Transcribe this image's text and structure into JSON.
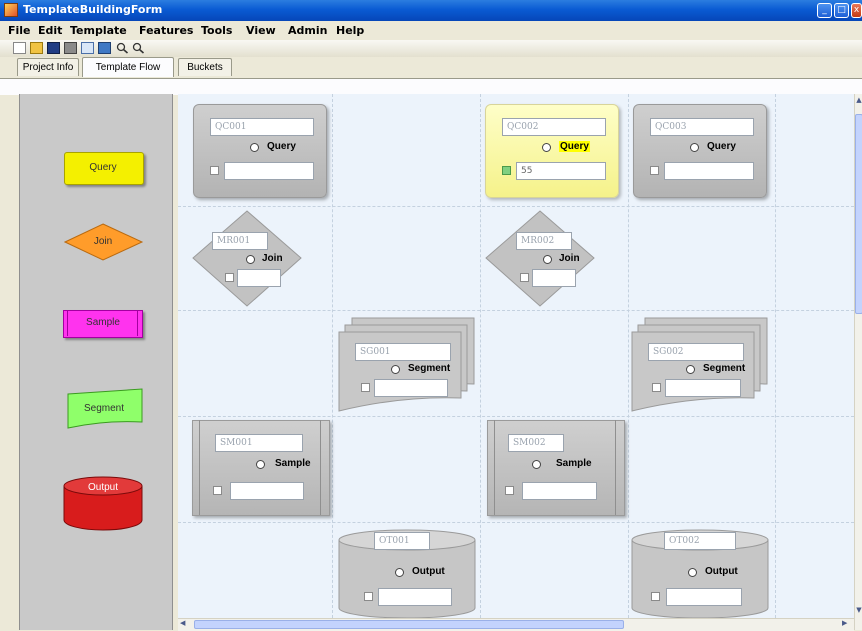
{
  "window": {
    "title": "TemplateBuildingForm"
  },
  "menu": [
    "File",
    "Edit",
    "Template",
    "Features",
    "Tools",
    "View",
    "Admin",
    "Help"
  ],
  "tabs": [
    "Project Info",
    "Template Flow",
    "Buckets"
  ],
  "active_tab": "Template Flow",
  "palette": [
    {
      "label": "Query",
      "color": "#f4f000"
    },
    {
      "label": "Join",
      "color": "#ff9c2a"
    },
    {
      "label": "Sample",
      "color": "#ff33ee"
    },
    {
      "label": "Segment",
      "color": "#8fff6a"
    },
    {
      "label": "Output",
      "color": "#d81c1c"
    }
  ],
  "nodes": {
    "qc001": {
      "id": "QC001",
      "type": "Query",
      "value": "",
      "checked": false,
      "highlighted": false
    },
    "qc002": {
      "id": "QC002",
      "type": "Query",
      "value": "55",
      "checked": true,
      "highlighted": true
    },
    "qc003": {
      "id": "QC003",
      "type": "Query",
      "value": "",
      "checked": false,
      "highlighted": false
    },
    "mr001": {
      "id": "MR001",
      "type": "Join",
      "value": "",
      "checked": false
    },
    "mr002": {
      "id": "MR002",
      "type": "Join",
      "value": "",
      "checked": false
    },
    "sg001": {
      "id": "SG001",
      "type": "Segment",
      "value": "",
      "checked": false
    },
    "sg002": {
      "id": "SG002",
      "type": "Segment",
      "value": "",
      "checked": false
    },
    "sm001": {
      "id": "SM001",
      "type": "Sample",
      "value": "",
      "checked": false
    },
    "sm002": {
      "id": "SM002",
      "type": "Sample",
      "value": "",
      "checked": false
    },
    "ot001": {
      "id": "OT001",
      "type": "Output",
      "value": "",
      "checked": false
    },
    "ot002": {
      "id": "OT002",
      "type": "Output",
      "value": "",
      "checked": false
    }
  },
  "colors": {
    "node_gray": "#bfbfbf",
    "highlight_yellow": "#fdfca8",
    "canvas_bg": "#ecf3fb",
    "check_green": "#80d080"
  },
  "icons": [
    "new-icon",
    "open-icon",
    "save-icon",
    "print-icon",
    "document-icon",
    "database-icon",
    "zoom-in-icon",
    "zoom-out-icon"
  ]
}
